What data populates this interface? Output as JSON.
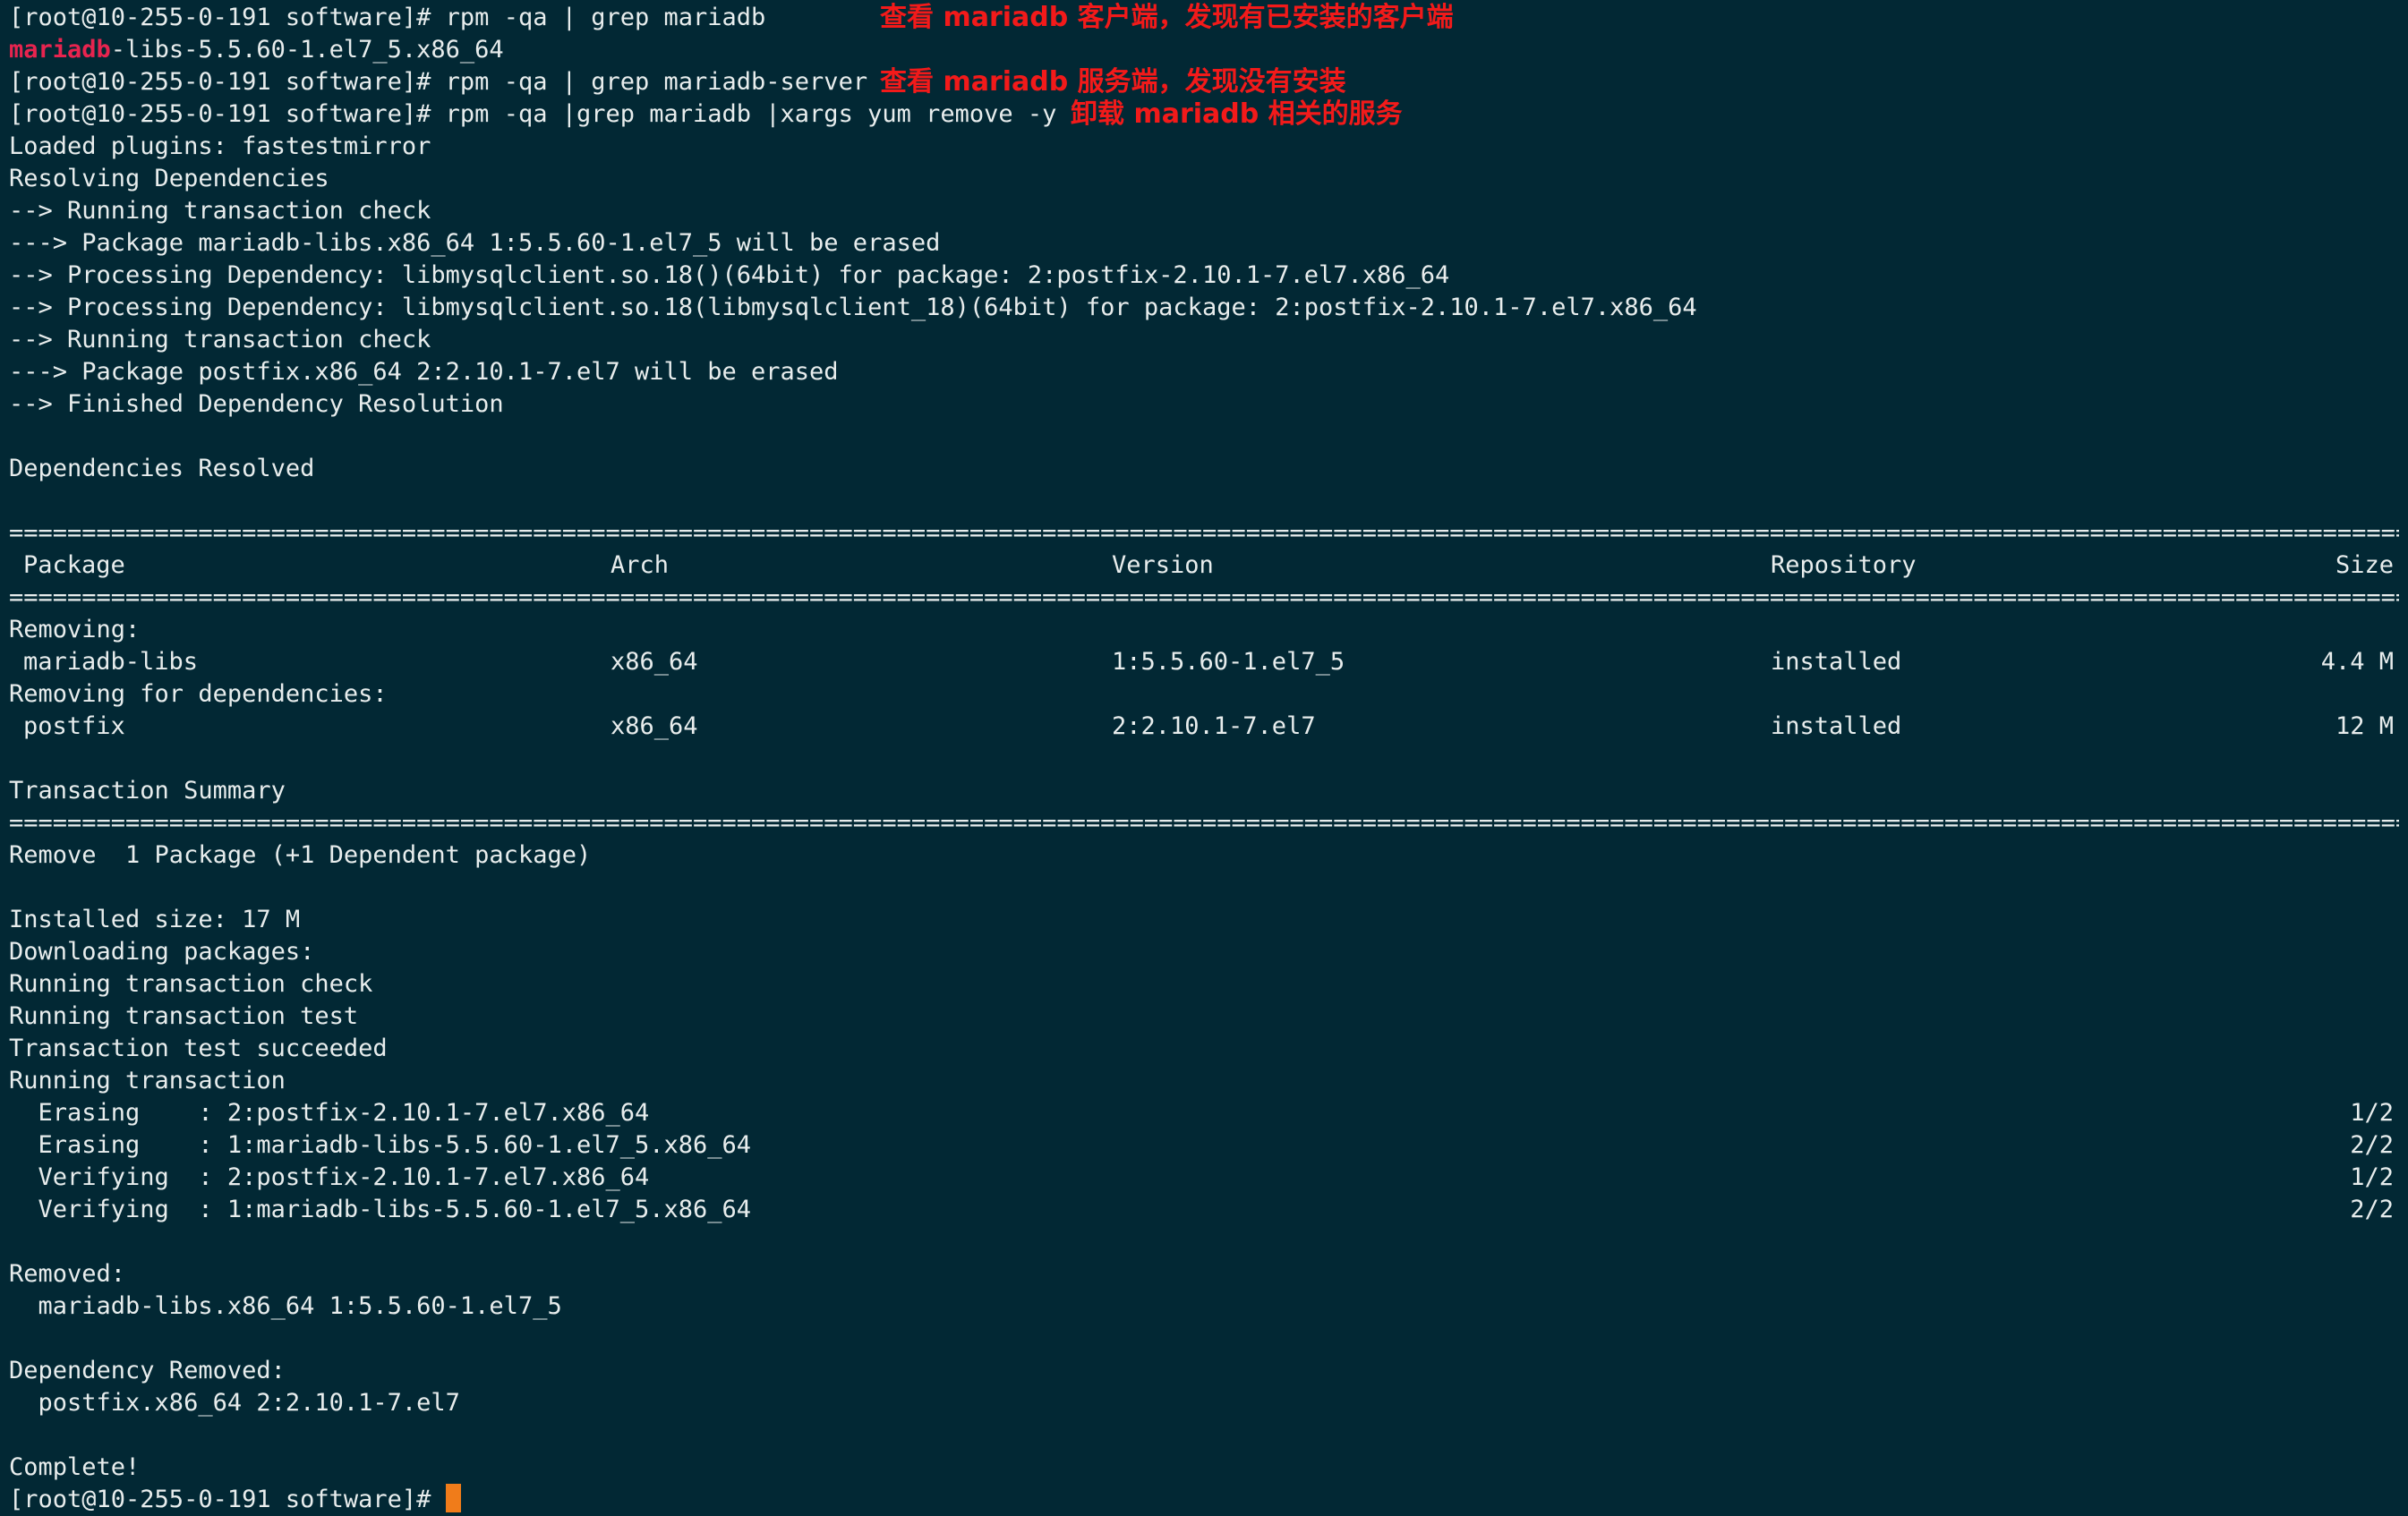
{
  "prompt": "[root@10-255-0-191 software]# ",
  "cmd1": "rpm -qa | grep mariadb",
  "note1": "查看 mariadb 客户端，发现有已安装的客户端",
  "out1_highlight": "mariadb",
  "out1_rest": "-libs-5.5.60-1.el7_5.x86_64",
  "cmd2": "rpm -qa | grep mariadb-server",
  "note2": "查看 mariadb 服务端，发现没有安装",
  "cmd3": "rpm -qa |grep mariadb |xargs yum remove -y",
  "note3": "卸载 mariadb 相关的服务",
  "yum_log": [
    "Loaded plugins: fastestmirror",
    "Resolving Dependencies",
    "--> Running transaction check",
    "---> Package mariadb-libs.x86_64 1:5.5.60-1.el7_5 will be erased",
    "--> Processing Dependency: libmysqlclient.so.18()(64bit) for package: 2:postfix-2.10.1-7.el7.x86_64",
    "--> Processing Dependency: libmysqlclient.so.18(libmysqlclient_18)(64bit) for package: 2:postfix-2.10.1-7.el7.x86_64",
    "--> Running transaction check",
    "---> Package postfix.x86_64 2:2.10.1-7.el7 will be erased",
    "--> Finished Dependency Resolution"
  ],
  "deps_resolved": "Dependencies Resolved",
  "rule": "====================================================================================================================================================================================================",
  "table": {
    "headers": [
      "Package",
      "Arch",
      "Version",
      "Repository",
      "Size"
    ],
    "removing_label": "Removing:",
    "row1": [
      "mariadb-libs",
      "x86_64",
      "1:5.5.60-1.el7_5",
      "installed",
      "4.4 M"
    ],
    "removing_deps_label": "Removing for dependencies:",
    "row2": [
      "postfix",
      "x86_64",
      "2:2.10.1-7.el7",
      "installed",
      "12 M"
    ]
  },
  "transaction_summary": "Transaction Summary",
  "remove_summary": "Remove  1 Package (+1 Dependent package)",
  "tail_log": [
    "Installed size: 17 M",
    "Downloading packages:",
    "Running transaction check",
    "Running transaction test",
    "Transaction test succeeded",
    "Running transaction"
  ],
  "steps": [
    {
      "text": "  Erasing    : 2:postfix-2.10.1-7.el7.x86_64",
      "count": "1/2"
    },
    {
      "text": "  Erasing    : 1:mariadb-libs-5.5.60-1.el7_5.x86_64",
      "count": "2/2"
    },
    {
      "text": "  Verifying  : 2:postfix-2.10.1-7.el7.x86_64",
      "count": "1/2"
    },
    {
      "text": "  Verifying  : 1:mariadb-libs-5.5.60-1.el7_5.x86_64",
      "count": "2/2"
    }
  ],
  "removed_label": "Removed:",
  "removed_item": "  mariadb-libs.x86_64 1:5.5.60-1.el7_5",
  "dep_removed_label": "Dependency Removed:",
  "dep_removed_item": "  postfix.x86_64 2:2.10.1-7.el7",
  "complete": "Complete!",
  "final_prompt": "[root@10-255-0-191 software]# "
}
